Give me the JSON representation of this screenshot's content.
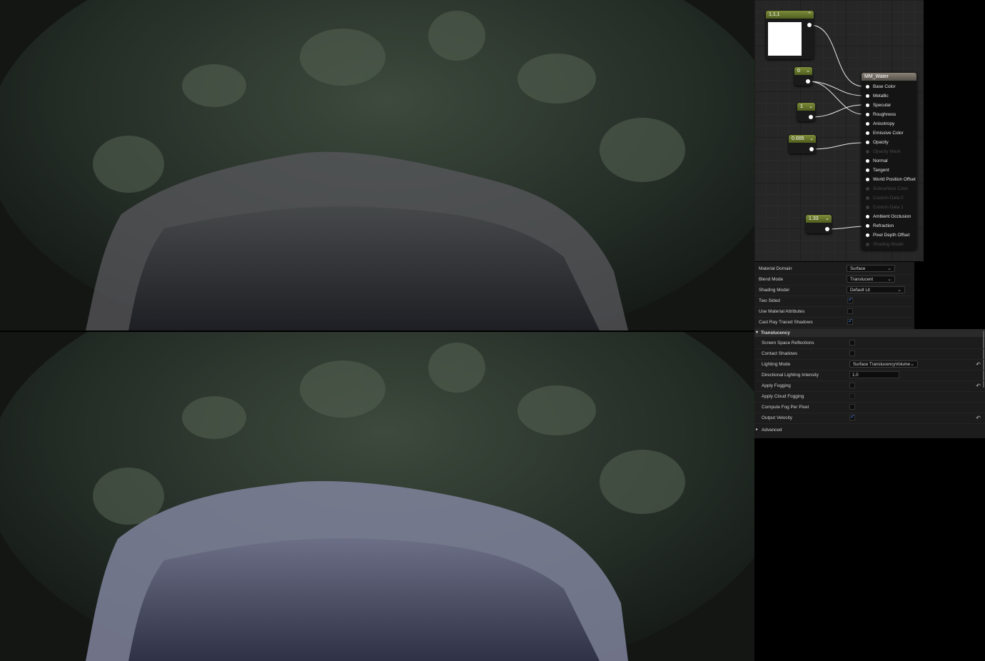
{
  "graph": {
    "constants": [
      {
        "id": "base-color",
        "value": "1,1,1"
      },
      {
        "id": "metallic",
        "value": "0"
      },
      {
        "id": "roughness",
        "value": "1"
      },
      {
        "id": "opacity",
        "value": "0.005"
      },
      {
        "id": "refraction",
        "value": "1.33"
      }
    ],
    "material_node": {
      "title": "MM_Water",
      "inputs": [
        {
          "label": "Base Color",
          "enabled": true
        },
        {
          "label": "Metallic",
          "enabled": true
        },
        {
          "label": "Specular",
          "enabled": true
        },
        {
          "label": "Roughness",
          "enabled": true
        },
        {
          "label": "Anisotropy",
          "enabled": true
        },
        {
          "label": "Emissive Color",
          "enabled": true
        },
        {
          "label": "Opacity",
          "enabled": true
        },
        {
          "label": "Opacity Mask",
          "enabled": false
        },
        {
          "label": "Normal",
          "enabled": true
        },
        {
          "label": "Tangent",
          "enabled": true
        },
        {
          "label": "World Position Offset",
          "enabled": true
        },
        {
          "label": "Subsurface Color",
          "enabled": false
        },
        {
          "label": "Custom Data 0",
          "enabled": false
        },
        {
          "label": "Custom Data 1",
          "enabled": false
        },
        {
          "label": "Ambient Occlusion",
          "enabled": true
        },
        {
          "label": "Refraction",
          "enabled": true
        },
        {
          "label": "Pixel Depth Offset",
          "enabled": true
        },
        {
          "label": "Shading Model",
          "enabled": false
        }
      ]
    }
  },
  "details": {
    "material_domain": {
      "label": "Material Domain",
      "value": "Surface"
    },
    "blend_mode": {
      "label": "Blend Mode",
      "value": "Translucent"
    },
    "shading_model": {
      "label": "Shading Model",
      "value": "Default Lit"
    },
    "two_sided": {
      "label": "Two Sided",
      "checked": true
    },
    "use_material_attributes": {
      "label": "Use Material Attributes",
      "checked": false
    },
    "cast_ray_traced_shadows": {
      "label": "Cast Ray Traced Shadows",
      "checked": true
    }
  },
  "translucency": {
    "title": "Translucency",
    "screen_space_reflections": {
      "label": "Screen Space Reflections",
      "checked": false
    },
    "contact_shadows": {
      "label": "Contact Shadows",
      "checked": false
    },
    "lighting_mode": {
      "label": "Lighting Mode",
      "value": "Surface TranslucencyVolume"
    },
    "directional_lighting_intensity": {
      "label": "Directional Lighting Intensity",
      "value": "1.0"
    },
    "apply_fogging": {
      "label": "Apply Fogging",
      "checked": false
    },
    "apply_cloud_fogging": {
      "label": "Apply Cloud Fogging",
      "checked": false
    },
    "compute_fog_per_pixel": {
      "label": "Compute Fog Per Pixel",
      "checked": false
    },
    "output_velocity": {
      "label": "Output Velocity",
      "checked": true
    },
    "advanced": {
      "label": "Advanced"
    }
  },
  "icons": {
    "chevron": "chevron-down-icon",
    "reset": "reset-arrow-icon",
    "expand": "expand-triangle-icon"
  }
}
